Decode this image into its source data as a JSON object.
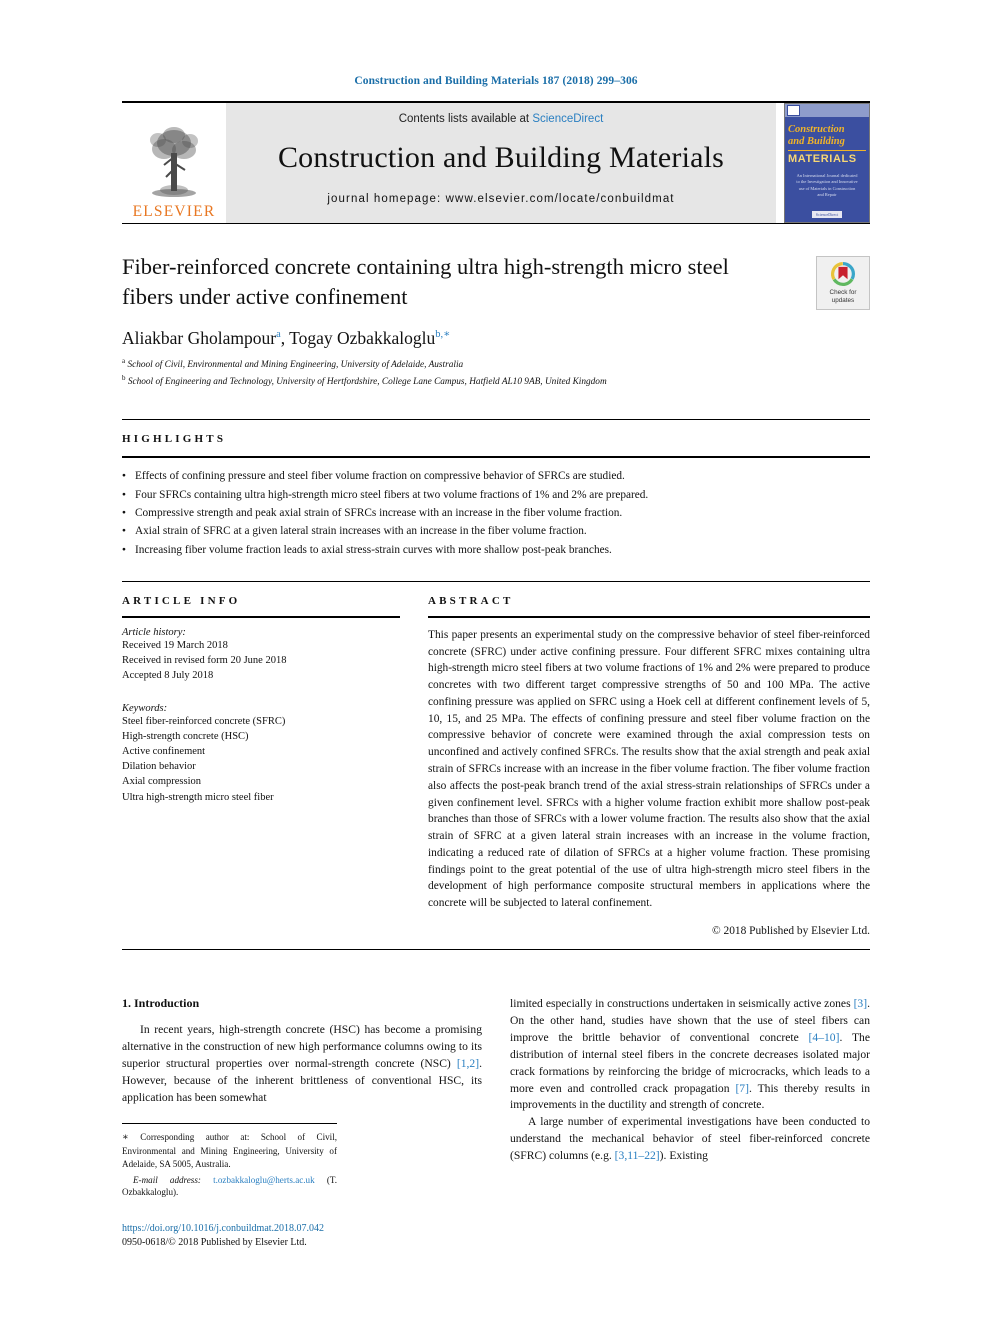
{
  "running_head": "Construction and Building Materials 187 (2018) 299–306",
  "masthead": {
    "publisher_name": "ELSEVIER",
    "contents_prefix": "Contents lists available at ",
    "contents_link": "ScienceDirect",
    "journal_title": "Construction and Building Materials",
    "homepage": "journal homepage: www.elsevier.com/locate/conbuildmat",
    "cover": {
      "title_line1": "Construction",
      "title_line2": "and Building",
      "title_line3": "MATERIALS",
      "subtitle": "An International Journal dedicated to the Investigation and Innovative use of Materials in Construction and Repair",
      "footer_mark": "ScienceDirect"
    }
  },
  "article": {
    "title": "Fiber-reinforced concrete containing ultra high-strength micro steel fibers under active confinement",
    "crossmark_line1": "Check for",
    "crossmark_line2": "updates",
    "authors": [
      {
        "name": "Aliakbar Gholampour",
        "marker": "a",
        "separator": ", "
      },
      {
        "name": "Togay Ozbakkaloglu",
        "marker": "b,∗",
        "separator": ""
      }
    ],
    "affiliations": [
      {
        "marker": "a",
        "text": "School of Civil, Environmental and Mining Engineering, University of Adelaide, Australia"
      },
      {
        "marker": "b",
        "text": "School of Engineering and Technology, University of Hertfordshire, College Lane Campus, Hatfield AL10 9AB, United Kingdom"
      }
    ]
  },
  "highlights": {
    "heading": "HIGHLIGHTS",
    "items": [
      "Effects of confining pressure and steel fiber volume fraction on compressive behavior of SFRCs are studied.",
      "Four SFRCs containing ultra high-strength micro steel fibers at two volume fractions of 1% and 2% are prepared.",
      "Compressive strength and peak axial strain of SFRCs increase with an increase in the fiber volume fraction.",
      "Axial strain of SFRC at a given lateral strain increases with an increase in the fiber volume fraction.",
      "Increasing fiber volume fraction leads to axial stress-strain curves with more shallow post-peak branches."
    ]
  },
  "article_info": {
    "heading": "ARTICLE INFO",
    "history_title": "Article history:",
    "history": [
      "Received 19 March 2018",
      "Received in revised form 20 June 2018",
      "Accepted 8 July 2018"
    ],
    "keywords_title": "Keywords:",
    "keywords": [
      "Steel fiber-reinforced concrete (SFRC)",
      "High-strength concrete (HSC)",
      "Active confinement",
      "Dilation behavior",
      "Axial compression",
      "Ultra high-strength micro steel fiber"
    ]
  },
  "abstract": {
    "heading": "ABSTRACT",
    "text": "This paper presents an experimental study on the compressive behavior of steel fiber-reinforced concrete (SFRC) under active confining pressure. Four different SFRC mixes containing ultra high-strength micro steel fibers at two volume fractions of 1% and 2% were prepared to produce concretes with two different target compressive strengths of 50 and 100 MPa. The active confining pressure was applied on SFRC using a Hoek cell at different confinement levels of 5, 10, 15, and 25 MPa. The effects of confining pressure and steel fiber volume fraction on the compressive behavior of concrete were examined through the axial compression tests on unconfined and actively confined SFRCs. The results show that the axial strength and peak axial strain of SFRCs increase with an increase in the fiber volume fraction. The fiber volume fraction also affects the post-peak branch trend of the axial stress-strain relationships of SFRCs under a given confinement level. SFRCs with a higher volume fraction exhibit more shallow post-peak branches than those of SFRCs with a lower volume fraction. The results also show that the axial strain of SFRC at a given lateral strain increases with an increase in the volume fraction, indicating a reduced rate of dilation of SFRCs at a higher volume fraction. These promising findings point to the great potential of the use of ultra high-strength micro steel fibers in the development of high performance composite structural members in applications where the concrete will be subjected to lateral confinement.",
    "copyright": "© 2018 Published by Elsevier Ltd."
  },
  "introduction": {
    "heading": "1. Introduction",
    "left_para": {
      "part1": "In recent years, high-strength concrete (HSC) has become a promising alternative in the construction of new high performance columns owing to its superior structural properties over normal-strength concrete (NSC) ",
      "ref1": "[1,2]",
      "part2": ". However, because of the inherent brittleness of conventional HSC, its application has been somewhat"
    },
    "right_para1": {
      "part1": "limited especially in constructions undertaken in seismically active zones ",
      "ref1": "[3]",
      "part2": ". On the other hand, studies have shown that the use of steel fibers can improve the brittle behavior of conventional concrete ",
      "ref2": "[4–10]",
      "part3": ". The distribution of internal steel fibers in the concrete decreases isolated major crack formations by reinforcing the bridge of microcracks, which leads to a more even and controlled crack propagation ",
      "ref3": "[7]",
      "part4": ". This thereby results in improvements in the ductility and strength of concrete."
    },
    "right_para2": {
      "part1": "A large number of experimental investigations have been conducted to understand the mechanical behavior of steel fiber-reinforced concrete (SFRC) columns (e.g. ",
      "ref1": "[3,11–22]",
      "part2": "). Existing"
    }
  },
  "footnote": {
    "star": "∗",
    "text": "Corresponding author at: School of Civil, Environmental and Mining Engineering, University of Adelaide, SA 5005, Australia.",
    "email_label": "E-mail address:",
    "email": "t.ozbakkaloglu@herts.ac.uk",
    "email_suffix": "(T. Ozbakkaloglu)."
  },
  "footer": {
    "doi": "https://doi.org/10.1016/j.conbuildmat.2018.07.042",
    "issn": "0950-0618/© 2018 Published by Elsevier Ltd."
  },
  "colors": {
    "link_blue": "#2a7fc1",
    "header_blue": "#1a6ea8",
    "elsevier_orange": "#E87722",
    "cover_blue": "#3b4fa0"
  }
}
